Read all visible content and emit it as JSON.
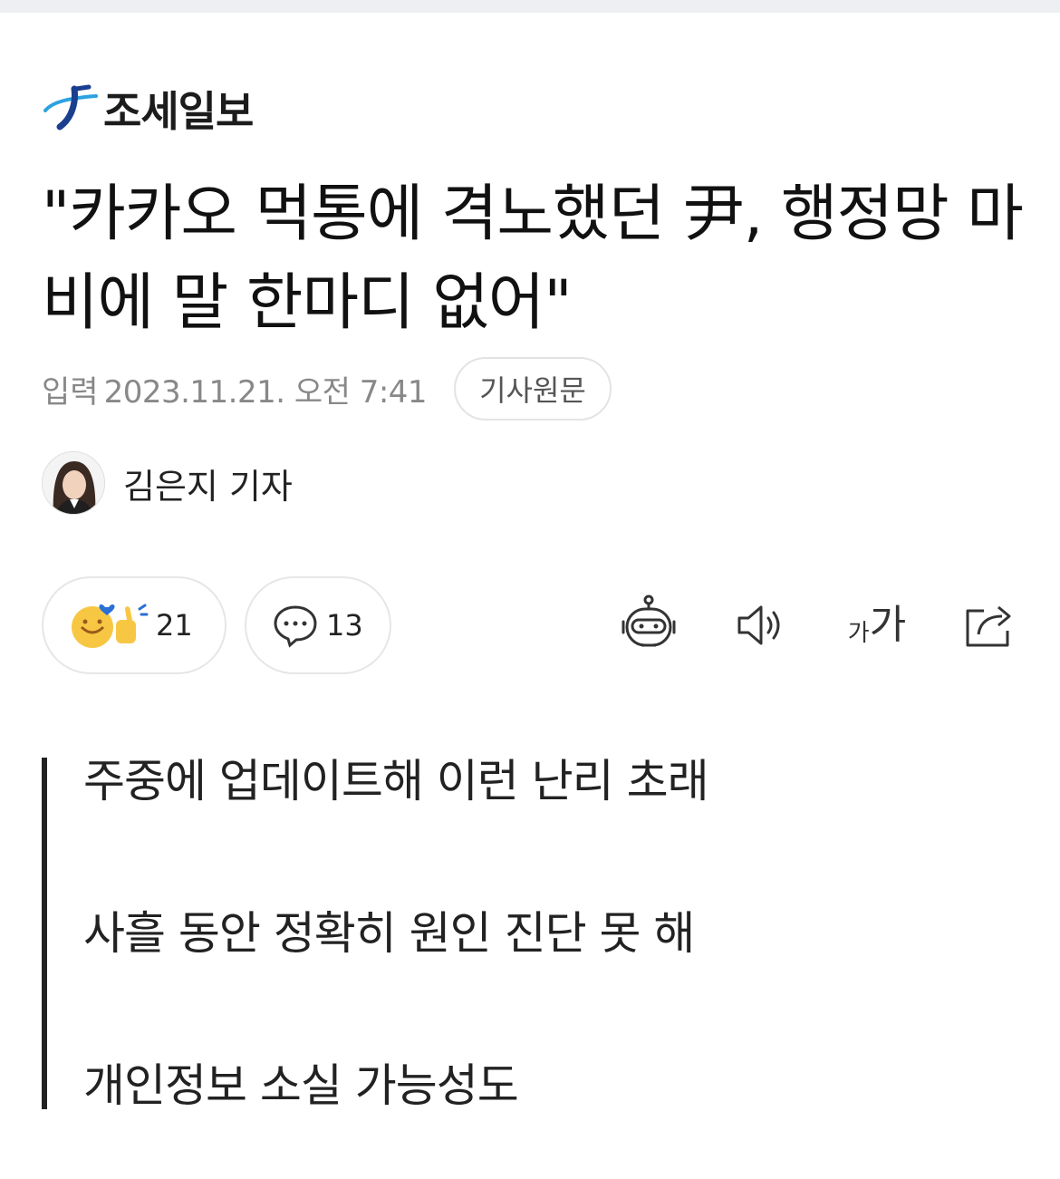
{
  "publisher": {
    "name": "조세일보",
    "logo_icon": "jo-se-ilbo-logo-icon"
  },
  "headline": "\"카카오 먹통에 격노했던 尹, 행정망 마비에 말 한마디 없어\"",
  "meta": {
    "label": "입력",
    "datetime": "2023.11.21. 오전 7:41",
    "original_button": "기사원문"
  },
  "author": {
    "name": "김은지 기자"
  },
  "actions": {
    "reaction_count": "21",
    "comment_count": "13",
    "tools": [
      "summary-bot-icon",
      "speaker-icon",
      "font-size-icon",
      "share-icon"
    ],
    "font_label_small": "가",
    "font_label_large": "가"
  },
  "summary": [
    "주중에 업데이트해 이런 난리 초래",
    "사흘 동안 정확히 원인 진단 못 해",
    "개인정보 소실 가능성도"
  ],
  "colors": {
    "text": "#111111",
    "muted": "#888888",
    "border": "#e3e3e3",
    "accent_blue": "#2a6fd6",
    "emoji_yellow": "#f7c744"
  }
}
